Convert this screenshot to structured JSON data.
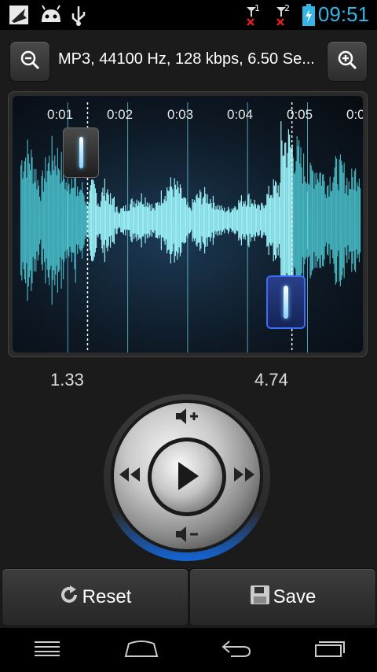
{
  "status_bar": {
    "time": "09:51",
    "icons": [
      "notification-icon",
      "android-icon",
      "usb-icon",
      "signal-sim1-icon",
      "signal-sim2-icon",
      "battery-charging-icon"
    ],
    "sim1_label": "1",
    "sim2_label": "2",
    "accent_color": "#33b5e5"
  },
  "top_bar": {
    "info_text": "MP3, 44100 Hz, 128 kbps, 6.50 Se...",
    "zoom_out_icon": "zoom-out-icon",
    "zoom_in_icon": "zoom-in-icon"
  },
  "waveform": {
    "time_labels": [
      "0:01",
      "0:02",
      "0:03",
      "0:04",
      "0:05",
      "0:0"
    ],
    "wave_color": "#55e3ee",
    "selected_wave_color": "#9ff8ff",
    "duration_seconds": 6.5,
    "selection_start": 1.33,
    "selection_end": 4.74
  },
  "selection": {
    "start_value": "1.33",
    "end_value": "4.74"
  },
  "controls": {
    "volume_up_icon": "volume-up-icon",
    "volume_down_icon": "volume-down-icon",
    "rewind_icon": "rewind-icon",
    "fast_forward_icon": "fast-forward-icon",
    "play_icon": "play-icon"
  },
  "actions": {
    "reset_label": "Reset",
    "save_label": "Save"
  },
  "nav_bar": {
    "icons": [
      "menu-icon",
      "home-icon",
      "back-icon",
      "recent-apps-icon"
    ]
  }
}
